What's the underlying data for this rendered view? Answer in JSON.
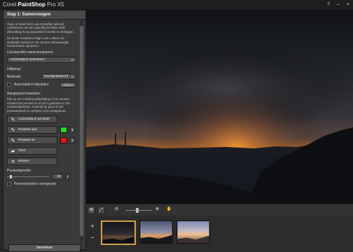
{
  "app": {
    "title_prefix": "Corel",
    "title_main": "PaintShop",
    "title_suffix": "Pro X5",
    "help": "?",
    "minimize": "–",
    "close": "×"
  },
  "panel": {
    "step_title": "Stap 1: Samenvoegen",
    "intro_1": "Twee of meer foto's van hetzelfde tafereel combineren om een prachtig belichte HDR-afbeelding (hoog dynamisch bereik) te verkrijgen.",
    "intro_2": "De beste resultaten krijgt u als u alleen de sluitertijd varieert en de camera onbeweeglijk houdt tussen opnamen.",
    "curve_label": "Curveprofiel cameraresponse:",
    "curve_value": "Automatisch selecteren",
    "align_label": "Uitlijning:",
    "method_label": "Methode:",
    "method_value": "Randgebaseerd",
    "autocrop_label": "Automatisch bijsnijden",
    "align_button": "Uitlijnen",
    "custom_label": "Aangepast bewerken:",
    "custom_text": "Klik op een miniatuurafbeelding in het venster, schakel het penseel in of uit in gebieden in het voorbeeldvenster. Gebruik de gum of een penseelstreek te verfijnen of te verwijderen.",
    "auto_brush": "Automatisch penseel",
    "brush_on": "Penseel aan",
    "brush_off": "Penseel uit",
    "eraser": "Gum",
    "clear": "Wissen",
    "brush_size_label": "Penseelgrootte:",
    "brush_size_value": "50",
    "show_strokes": "Penseelstreken weergeven",
    "apply": "Verwerken"
  },
  "colors": {
    "brush_on_swatch": "#22dd22",
    "brush_off_swatch": "#ee1111",
    "selected_border": "#d4a04a"
  },
  "icons": {
    "split_view": "split-view-icon",
    "fit": "fit-icon",
    "zoom_out": "zoom-out-icon",
    "zoom_in": "zoom-in-icon",
    "pan": "hand-icon",
    "add": "plus-icon",
    "remove": "minus-icon"
  },
  "filmstrip": {
    "add": "+",
    "remove": "−",
    "thumbnails": [
      {
        "name": "thumb-1",
        "selected": true
      },
      {
        "name": "thumb-2",
        "selected": false
      },
      {
        "name": "thumb-3",
        "selected": false
      }
    ]
  }
}
